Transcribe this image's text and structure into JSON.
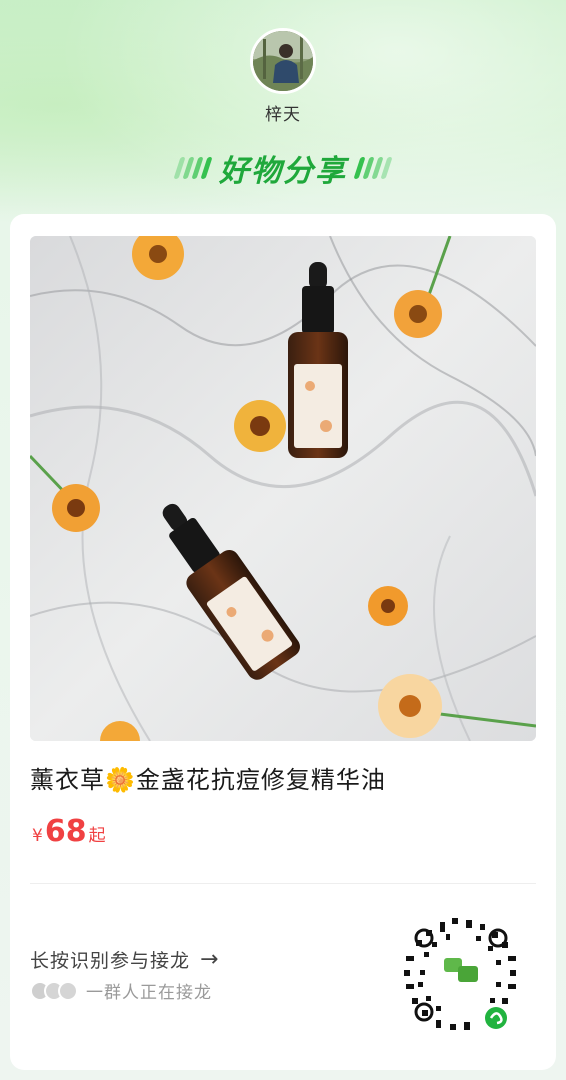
{
  "header": {
    "author_name": "梓天",
    "section_title": "好物分享"
  },
  "product": {
    "title": "薰衣草🌼金盏花抗痘修复精华油",
    "price_currency": "¥",
    "price_value": "68",
    "price_suffix": "起"
  },
  "cta": {
    "label": "长按识别参与接龙",
    "arrow": "→",
    "participants_text": "一群人正在接龙"
  },
  "colors": {
    "accent_green": "#1fa83b",
    "price_red": "#f04142"
  },
  "icons": {
    "cta_arrow": "arrow-right-icon",
    "mini_program_code": "qr-code-icon"
  }
}
